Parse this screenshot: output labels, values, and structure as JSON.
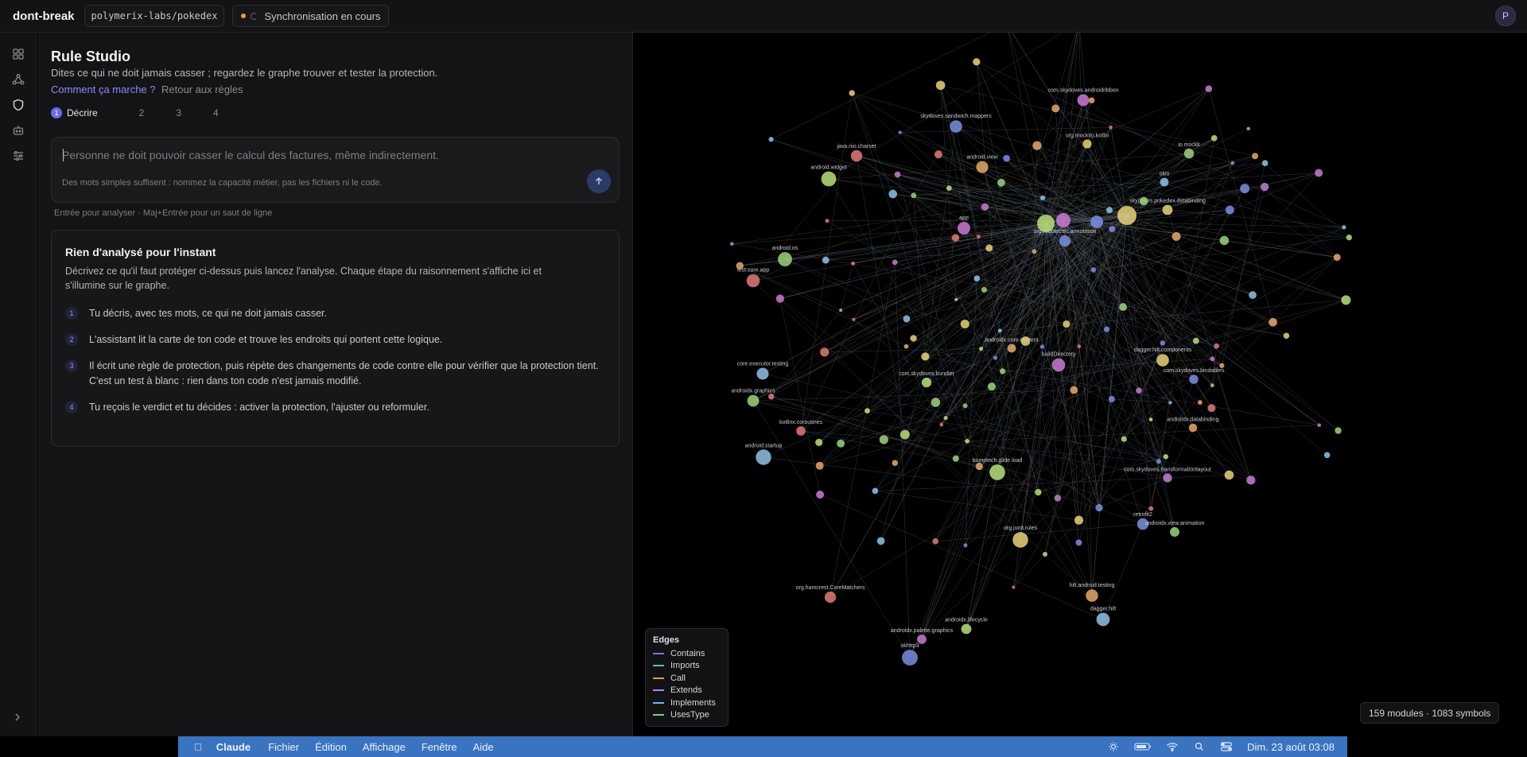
{
  "topbar": {
    "brand": "dont-break",
    "repo": "polymerix-labs/pokedex",
    "sync_status": "Synchronisation en cours",
    "avatar_initial": "P"
  },
  "rail": {
    "icons": [
      "dashboard-icon",
      "graph-icon",
      "shield-icon",
      "bot-icon",
      "sliders-icon"
    ],
    "active": "shield-icon"
  },
  "studio": {
    "title": "Rule Studio",
    "subtitle": "Dites ce qui ne doit jamais casser ; regardez le graphe trouver et tester la protection.",
    "how_link": "Comment ça marche ?",
    "back_link": "Retour aux règles",
    "steps": [
      {
        "num": "1",
        "label": "Décrire"
      },
      {
        "num": "2",
        "label": ""
      },
      {
        "num": "3",
        "label": ""
      },
      {
        "num": "4",
        "label": ""
      }
    ],
    "input_placeholder": "Personne ne doit pouvoir casser le calcul des factures, même indirectement.",
    "input_hint": "Des mots simples suffisent : nommez la capacité métier, pas les fichiers ni le code.",
    "keyboard_hint": "Entrée pour analyser · Maj+Entrée pour un saut de ligne",
    "empty": {
      "title": "Rien d'analysé pour l'instant",
      "description": "Décrivez ce qu'il faut protéger ci-dessus puis lancez l'analyse. Chaque étape du raisonnement s'affiche ici et s'illumine sur le graphe.",
      "stages": [
        {
          "num": "1",
          "text": "Tu décris, avec tes mots, ce qui ne doit jamais casser."
        },
        {
          "num": "2",
          "text": "L'assistant lit la carte de ton code et trouve les endroits qui portent cette logique."
        },
        {
          "num": "3",
          "text": "Il écrit une règle de protection, puis répète des changements de code contre elle pour vérifier que la protection tient. C'est un test à blanc : rien dans ton code n'est jamais modifié."
        },
        {
          "num": "4",
          "text": "Tu reçois le verdict et tu décides : activer la protection, l'ajuster ou reformuler."
        }
      ]
    }
  },
  "graph": {
    "legend_title": "Edges",
    "legend": [
      {
        "label": "Contains",
        "color": "#6c7bd6"
      },
      {
        "label": "Imports",
        "color": "#58b8c9"
      },
      {
        "label": "Call",
        "color": "#e0a33c"
      },
      {
        "label": "Extends",
        "color": "#a78bfa"
      },
      {
        "label": "Implements",
        "color": "#6fb7f5"
      },
      {
        "label": "UsesType",
        "color": "#7fd07a"
      }
    ],
    "counts": "159 modules · 1083 symbols",
    "labels": [
      "com.skydoves.androidribbon",
      "skydoves.sandwich.mappers",
      "org.mockito.kotlin",
      "io.mockk",
      "java.nio.charset",
      "android.view",
      "okio",
      "android.widget",
      "app",
      "org.robolectric.annotation",
      "skydoves.pokedex.databinding",
      "android.os",
      "test.core.app",
      "androidx.core.content",
      "core.executor.testing",
      "com.skydoves.bundler",
      "buildDirectory",
      "com.skydoves.bindables",
      "dagger.hilt.components",
      "androidx.graphics",
      "kotlinx.coroutines",
      "androidx.databinding",
      "android.startup",
      "bumptech.glide.load",
      "com.skydoves.transformationlayout",
      "retrofit2",
      "org.junit.rules",
      "androidx.view.animation",
      "org.hamcrest.CoreMatchers",
      "hilt.android.testing",
      "dagger.hilt",
      "androidx.lifecycle",
      "androidx.palette.graphics",
      "okhttp3"
    ]
  },
  "menubar": {
    "app_name": "Claude",
    "menus": [
      "Fichier",
      "Édition",
      "Affichage",
      "Fenêtre",
      "Aide"
    ],
    "clock": "Dim. 23 août 03:08"
  }
}
